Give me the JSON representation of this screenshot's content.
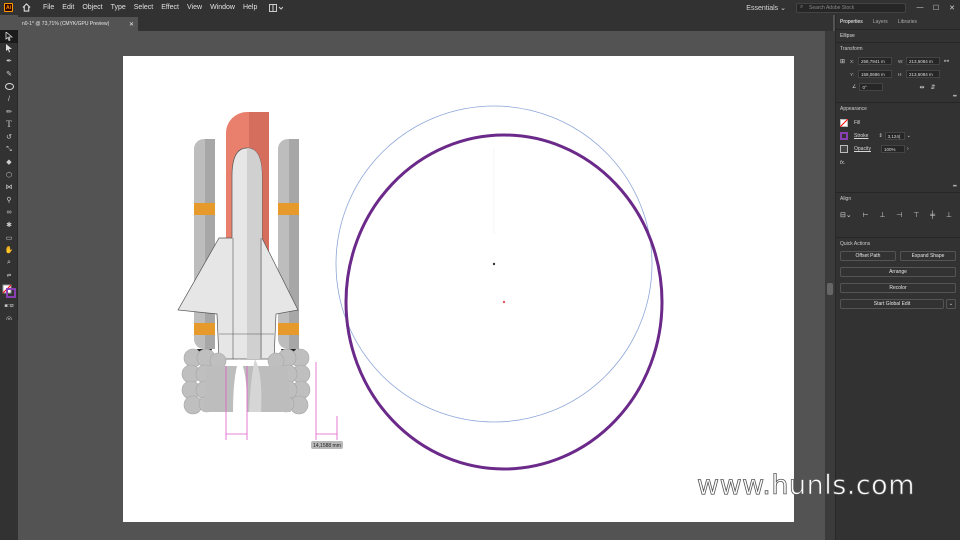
{
  "app": {
    "logo": "Ai",
    "menus": [
      "File",
      "Edit",
      "Object",
      "Type",
      "Select",
      "Effect",
      "View",
      "Window",
      "Help"
    ]
  },
  "workspace": {
    "name": "Essentials",
    "search_placeholder": "Search Adobe Stock"
  },
  "doc_tab": {
    "title": "n0-1* @ 73,71% (CMYK/GPU Preview)"
  },
  "tools": [
    "selection-tool",
    "direct-selection-tool",
    "pen-tool",
    "curvature-tool",
    "ellipse-tool",
    "brush-tool",
    "pencil-tool",
    "type-tool",
    "rotate-tool",
    "scale-tool",
    "eraser-tool",
    "shape-builder-tool",
    "width-tool",
    "eyedropper-tool",
    "blend-tool",
    "symbol-tool",
    "artboard-tool",
    "hand-tool",
    "zoom-tool"
  ],
  "measure": {
    "label": "14,1588 mm"
  },
  "panel": {
    "tabs": [
      "Properties",
      "Layers",
      "Libraries"
    ],
    "object_type": "Ellipse",
    "transform": {
      "title": "Transform",
      "x_label": "X:",
      "x": "258,7941 m",
      "y_label": "Y:",
      "y": "158,0686 m",
      "w_label": "W:",
      "w": "213,6084 m",
      "h_label": "H:",
      "h": "213,6084 m",
      "angle": "0°"
    },
    "appearance": {
      "title": "Appearance",
      "fill_label": "Fill",
      "stroke_label": "Stroke",
      "stroke_value": "3,124(",
      "opacity_label": "Opacity",
      "opacity_value": "100%",
      "fx": "fx."
    },
    "align": {
      "title": "Align"
    },
    "quick_actions": {
      "title": "Quick Actions",
      "offset_path": "Offset Path",
      "expand_shape": "Expand Shape",
      "arrange": "Arrange",
      "recolor": "Recolor",
      "start_global_edit": "Start Global Edit"
    },
    "more": "•••"
  },
  "watermark": "www.hunls.com",
  "colors": {
    "selection_circle": "#6b2a8a",
    "bbox_circle": "#8da6d8",
    "smart_guide": "#e05ac8"
  }
}
